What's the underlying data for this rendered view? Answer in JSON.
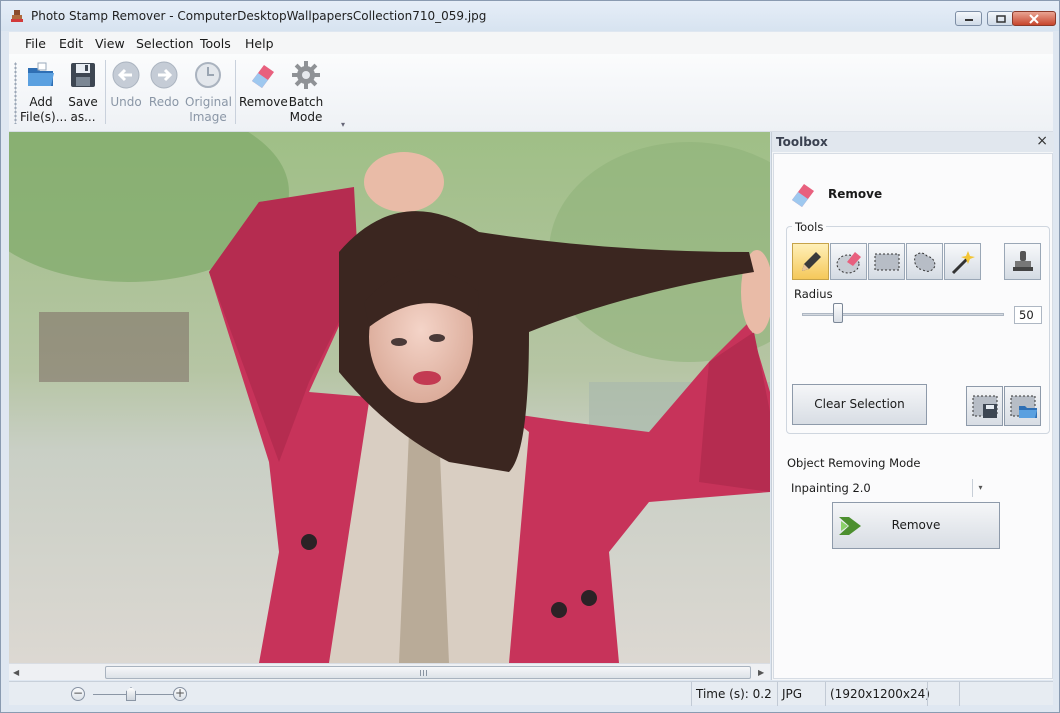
{
  "window": {
    "title": "Photo Stamp Remover - ComputerDesktopWallpapersCollection710_059.jpg"
  },
  "menu": {
    "items": [
      "File",
      "Edit",
      "View",
      "Selection",
      "Tools",
      "Help"
    ]
  },
  "toolbar": {
    "add_files": [
      "Add",
      "File(s)..."
    ],
    "save_as": [
      "Save",
      "as..."
    ],
    "undo": "Undo",
    "redo": "Redo",
    "original_image": [
      "Original",
      "Image"
    ],
    "remove": "Remove",
    "batch_mode": [
      "Batch",
      "Mode"
    ]
  },
  "toolbox": {
    "title": "Toolbox",
    "section": "Remove",
    "tools_label": "Tools",
    "radius_label": "Radius",
    "radius_value": "50",
    "radius_fraction": 0.18,
    "clear_selection": "Clear Selection",
    "mode_label": "Object Removing Mode",
    "mode_value": "Inpainting 2.0",
    "remove_button": "Remove"
  },
  "status": {
    "time": "Time (s): 0.2",
    "format": "JPG",
    "dimensions": "(1920x1200x24)"
  },
  "colors": {
    "accent": "#4c8f2f",
    "active_tool": "#f5c85a",
    "coat": "#c7335a"
  }
}
